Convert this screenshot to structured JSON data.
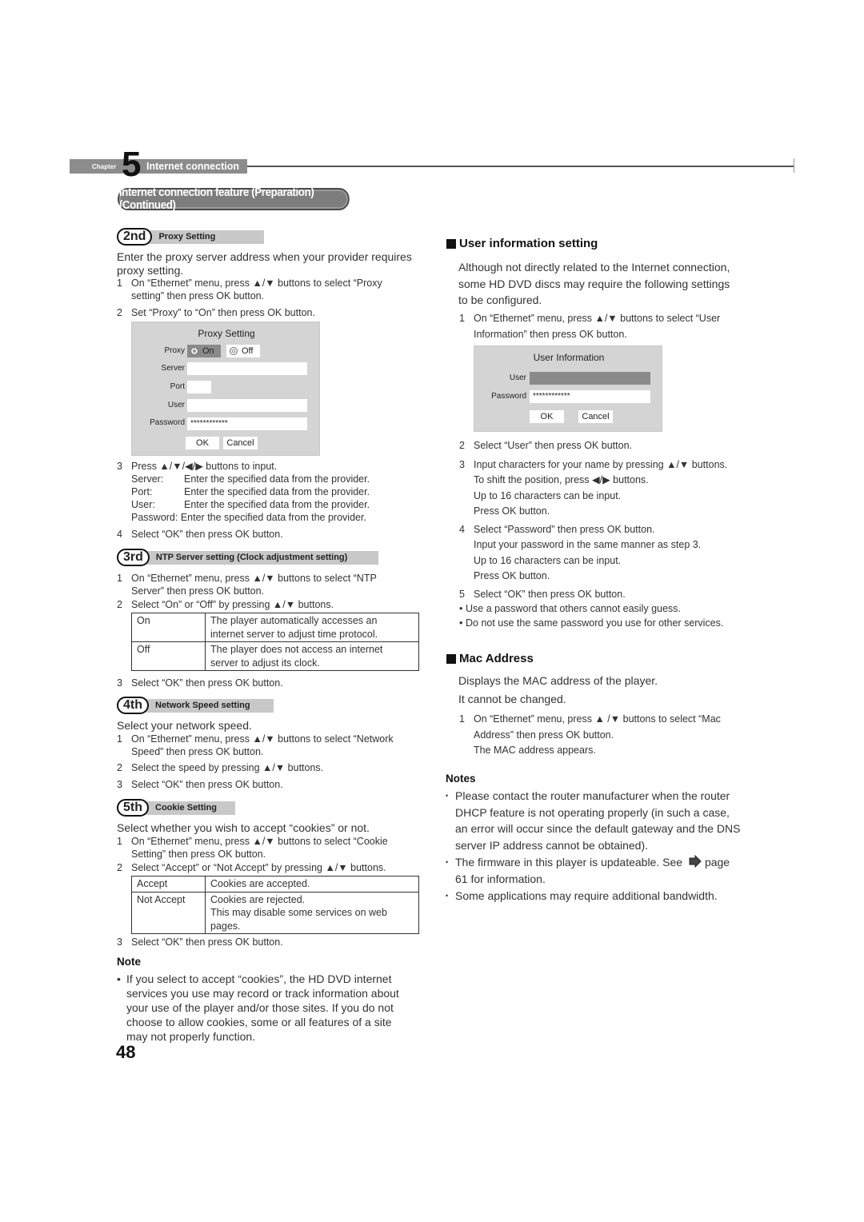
{
  "chapter": {
    "label": "Chapter",
    "number": "5",
    "title": "Internet connection"
  },
  "section_title": "Internet connection feature (Preparation) (Continued)",
  "proxy": {
    "badge": "2nd",
    "title": "Proxy Setting",
    "intro": "Enter the proxy server address when your provider requires proxy setting.",
    "steps": [
      {
        "n": "1",
        "text": "On “Ethernet” menu, press ▲/▼ buttons to select “Proxy",
        "text2": "setting” then press OK button."
      },
      {
        "n": "2",
        "text": "Set “Proxy” to “On” then press OK button."
      },
      {
        "n": "3",
        "text": "Press ▲/▼/◀/▶ buttons to input."
      },
      {
        "n": "4",
        "text": "Select “OK” then press OK button."
      }
    ],
    "fields_help": [
      {
        "label": "Server:",
        "text": "Enter the specified data from the provider."
      },
      {
        "label": "Port:",
        "text": "Enter the specified data from the provider."
      },
      {
        "label": "User:",
        "text": "Enter the specified data from the provider."
      },
      {
        "label": "Password:",
        "text": "Enter the specified data from the provider."
      }
    ],
    "dialog": {
      "title": "Proxy Setting",
      "proxy_label": "Proxy",
      "on_label": "On",
      "off_label": "Off",
      "selected": "On",
      "server_label": "Server",
      "server_value": "",
      "port_label": "Port",
      "port_value": "",
      "user_label": "User",
      "user_value": "",
      "password_label": "Password",
      "password_value": "************",
      "ok_label": "OK",
      "cancel_label": "Cancel"
    }
  },
  "ntp": {
    "badge": "3rd",
    "title": "NTP Server setting (Clock adjustment setting)",
    "step1a": "On “Ethernet” menu, press ▲/▼ buttons to select “NTP",
    "step1b": "Server” then press OK button.",
    "step2": "Select “On” or “Off” by pressing ▲/▼ buttons.",
    "options": [
      {
        "name": "On",
        "desc1": "The player automatically accesses an",
        "desc2": "internet server to adjust time protocol."
      },
      {
        "name": "Off",
        "desc1": "The player does not access an internet",
        "desc2": "server to adjust its clock."
      }
    ],
    "step3": "Select “OK” then press OK button."
  },
  "speed": {
    "badge": "4th",
    "title": "Network Speed setting",
    "intro": "Select your network speed.",
    "step1a": "On “Ethernet” menu, press ▲/▼ buttons to select “Network",
    "step1b": "Speed” then press OK button.",
    "step2": "Select the speed by pressing ▲/▼ buttons.",
    "step3": "Select “OK” then press OK button."
  },
  "cookie": {
    "badge": "5th",
    "title": "Cookie Setting",
    "intro": "Select whether you wish to accept “cookies” or not.",
    "step1a": "On “Ethernet” menu, press ▲/▼ buttons to select “Cookie",
    "step1b": "Setting” then press OK button.",
    "step2": "Select “Accept” or “Not Accept” by pressing ▲/▼ buttons.",
    "options": [
      {
        "name": "Accept",
        "desc1": "Cookies are accepted."
      },
      {
        "name": "Not Accept",
        "desc1": "Cookies are rejected.",
        "desc2": "This may disable some services on web",
        "desc3": "pages."
      }
    ],
    "step3": "Select “OK” then press OK button."
  },
  "note": {
    "label": "Note",
    "lines": [
      "If you select to accept “cookies”, the HD DVD internet",
      "services you use may record or track information about",
      "your use of the player and/or those sites.  If you do not",
      "choose to allow cookies, some or all features of a site",
      "may not properly function."
    ]
  },
  "page_number": "48",
  "user_info": {
    "heading": "User information setting",
    "intro": [
      "Although not directly related to the Internet connection,",
      "some HD DVD discs may require the following settings",
      "to be configured."
    ],
    "step1a": "On “Ethernet” menu, press ▲/▼ buttons to select “User",
    "step1b": "Information” then press OK button.",
    "dialog": {
      "title": "User Information",
      "user_label": "User",
      "user_value": "",
      "password_label": "Password",
      "password_value": "************",
      "ok_label": "OK",
      "cancel_label": "Cancel"
    },
    "step2": "Select “User” then press OK button.",
    "step3": [
      "Input characters for your name by pressing ▲/▼ buttons.",
      "To shift the position, press ◀/▶ buttons.",
      "Up to 16 characters can be input.",
      "Press OK button."
    ],
    "step4": [
      "Select “Password” then press OK button.",
      "Input your password in the same manner as step 3.",
      "Up to 16 characters can be input.",
      "Press OK button."
    ],
    "step5": "Select “OK” then press OK button.",
    "bullets": [
      "Use a password that others cannot easily guess.",
      "Do not use the same password you use for other services."
    ]
  },
  "mac": {
    "heading": "Mac Address",
    "intro1": "Displays the MAC address of the player.",
    "intro2": "It cannot be changed.",
    "step1a": "On “Ethernet” menu, press ▲ /▼ buttons to select “Mac",
    "step1b": "Address” then press OK button.",
    "step1c": "The MAC address appears."
  },
  "notes": {
    "label": "Notes",
    "items": [
      [
        "Please contact the router manufacturer when the router",
        "DHCP feature is not operating properly (in such a case,",
        "an error will occur since the default gateway and the DNS",
        "server IP address cannot be obtained)."
      ],
      [
        "The firmware in this player is updateable. See",
        "page",
        "61 for information."
      ],
      [
        "Some applications may require additional bandwidth."
      ]
    ]
  }
}
